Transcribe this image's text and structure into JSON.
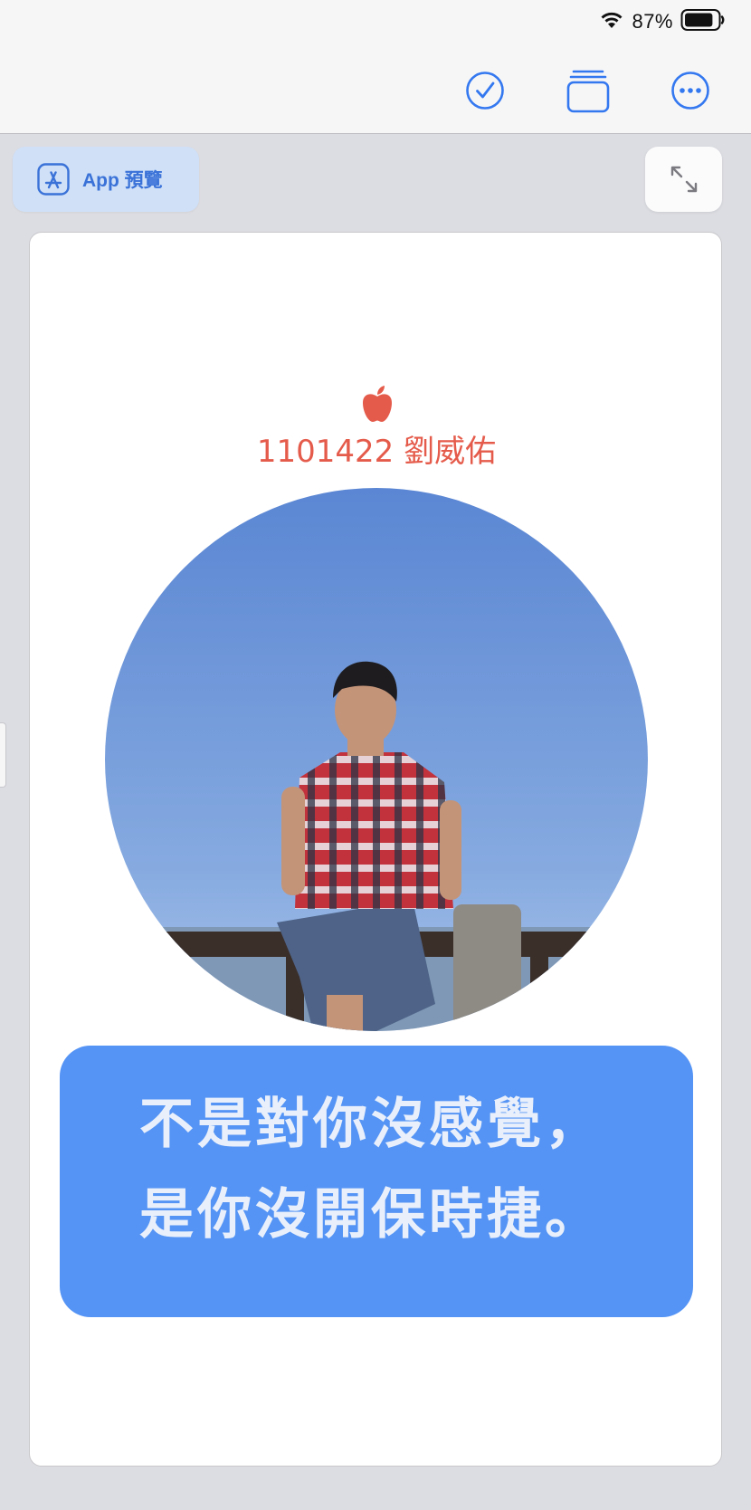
{
  "status_bar": {
    "battery_percent": "87%",
    "battery_level": 0.87,
    "wifi_icon": "wifi-icon"
  },
  "toolbar": {
    "buttons": [
      {
        "name": "done",
        "icon": "checkmark-circle-icon"
      },
      {
        "name": "gallery",
        "icon": "stack-icon"
      },
      {
        "name": "more",
        "icon": "ellipsis-circle-icon"
      }
    ]
  },
  "preview": {
    "app_preview_label": "App 預覽",
    "app_preview_icon": "app-store-icon",
    "expand_icon": "expand-arrows-icon"
  },
  "card": {
    "logo": "apple-logo",
    "student_line": "1101422 劉威佑",
    "photo_icon": "profile-photo",
    "quote_lines": [
      "不是對你沒感覺，",
      "是你沒開保時捷。"
    ]
  },
  "colors": {
    "accent_blue": "#3a72d8",
    "apple_red": "#e55b4b",
    "quote_bg": "#5594f5",
    "quote_text": "#e9f0fb"
  }
}
